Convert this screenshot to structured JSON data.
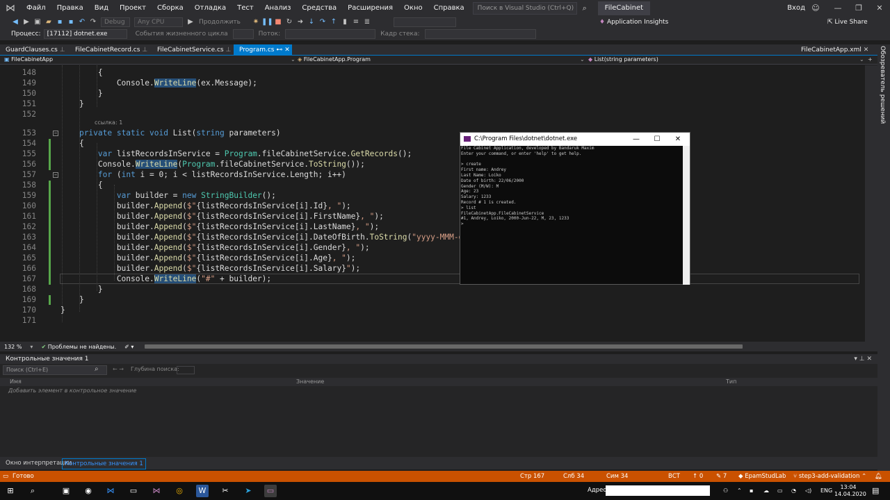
{
  "menubar": {
    "items": [
      "Файл",
      "Правка",
      "Вид",
      "Проект",
      "Сборка",
      "Отладка",
      "Тест",
      "Анализ",
      "Средства",
      "Расширения",
      "Окно",
      "Справка"
    ],
    "search_placeholder": "Поиск в Visual Studio (Ctrl+Q)",
    "solution_name": "FileCabinet",
    "signin": "Вход"
  },
  "toolbar": {
    "config": "Debug",
    "platform": "Any CPU",
    "continue": "Продолжить",
    "app_insights": "Application Insights",
    "live_share": "Live Share"
  },
  "process_bar": {
    "process_label": "Процесс:",
    "process_value": "[17112] dotnet.exe",
    "lifecycle": "События жизненного цикла",
    "thread_label": "Поток:",
    "stack_label": "Кадр стека:"
  },
  "tabs": [
    "GuardClauses.cs",
    "FileCabinetRecord.cs",
    "FileCabinetService.cs",
    "Program.cs",
    "FileCabinetApp.xml"
  ],
  "active_tab": "Program.cs",
  "navbar": {
    "project": "FileCabinetApp",
    "class": "FileCabinetApp.Program",
    "member": "List(string parameters)"
  },
  "side_panel_title": "Обозреватель решений",
  "editor": {
    "line_numbers": [
      "148",
      "149",
      "150",
      "151",
      "152",
      "153",
      "154",
      "155",
      "156",
      "157",
      "158",
      "159",
      "160",
      "161",
      "162",
      "163",
      "164",
      "165",
      "166",
      "167",
      "168",
      "169",
      "170",
      "171"
    ],
    "ref_hint": "ссылка: 1"
  },
  "console": {
    "title": "C:\\Program Files\\dotnet\\dotnet.exe",
    "lines": [
      "File Cabinet Application, developed by Bandaruk Maxim",
      "Enter your command, or enter 'help' to get help.",
      "",
      "> create",
      "First name: Andrey",
      "Last Name: Loiko",
      "Date of birth: 22/06/2000",
      "Gender (M/W): M",
      "Age: 23",
      "Salary: 1233",
      "Record # 1 is created.",
      "> list",
      "FileCabinetApp.FileCabinetService",
      "#1, Andrey, Loiko, 2000-Jun-22, M, 23, 1233",
      ">"
    ]
  },
  "editor_status": {
    "zoom": "132 %",
    "problems": "Проблемы не найдены."
  },
  "watch": {
    "title": "Контрольные значения 1",
    "search_placeholder": "Поиск (Ctrl+E)",
    "depth_label": "Глубина поиска:",
    "col_name": "Имя",
    "col_value": "Значение",
    "col_type": "Тип",
    "add_hint": "Добавить элемент в контрольное значение"
  },
  "panel_tabs": [
    "Окно интерпретации",
    "Контрольные значения 1"
  ],
  "statusbar": {
    "ready": "Готово",
    "line": "Стр 167",
    "col": "Слб 34",
    "ch": "Сим 34",
    "mode": "ВСТ",
    "errors": "0",
    "warnings": "7",
    "repo": "EpamStudLab",
    "branch": "step3-add-validation"
  },
  "taskbar": {
    "address_label": "Адрес",
    "lang": "ENG",
    "time": "13:04",
    "date": "14.04.2020"
  },
  "colors": {
    "accent": "#007acc",
    "statusbar": "#ca5100",
    "keyword": "#569cd6",
    "type": "#4ec9b0",
    "string": "#d69d85"
  }
}
